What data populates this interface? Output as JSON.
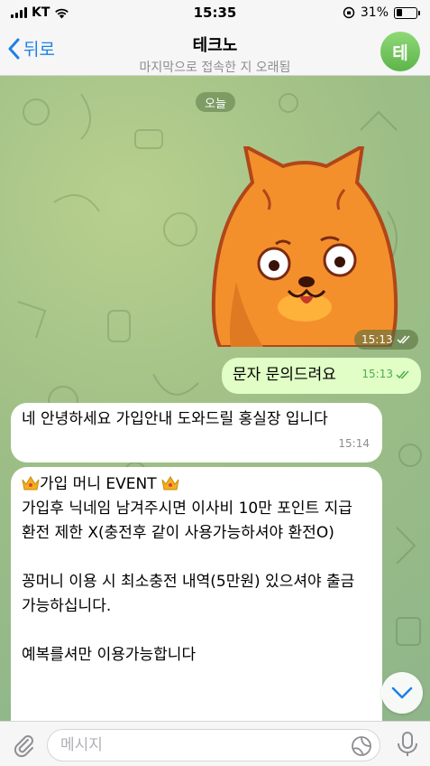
{
  "status_bar": {
    "carrier": "KT",
    "time": "15:35",
    "battery": "31%",
    "battery_level": 0.31
  },
  "header": {
    "back_label": "뒤로",
    "title": "테크노",
    "subtitle": "마지막으로 접속한 지 오래됨",
    "avatar_letter": "테"
  },
  "chat": {
    "date_label": "오늘",
    "sticker": {
      "time": "15:13",
      "status": "read"
    },
    "messages": [
      {
        "direction": "out",
        "text": "문자 문의드려요",
        "time": "15:13",
        "status": "read"
      },
      {
        "direction": "in",
        "text": "네 안녕하세요 가입안내 도와드릴 홍실장 입니다",
        "time": "15:14"
      },
      {
        "direction": "in",
        "text_lines": [
          "가입 머니 EVENT",
          "가입후 닉네임 남겨주시면 이사비 10만 포인트 지급",
          "환전 제한 X(충전후 같이 사용가능하셔야 환전O)",
          "꽁머니 이용 시 최소충전 내역(5만원) 있으셔야 출금 가능하십니다.",
          "예복를셔만 이용가능합니다"
        ]
      }
    ]
  },
  "input": {
    "placeholder": "메시지"
  },
  "colors": {
    "accent": "#1e80e6",
    "outgoing_bubble": "#e1fec6",
    "incoming_bubble": "#ffffff",
    "avatar": "#6cc257",
    "read_check": "#4fae4e"
  },
  "icons": {
    "back": "chevron-left-icon",
    "attach": "paperclip-icon",
    "sticker": "sticker-icon",
    "mic": "microphone-icon",
    "scroll_down": "chevron-down-icon",
    "crown": "crown-emoji-icon"
  }
}
